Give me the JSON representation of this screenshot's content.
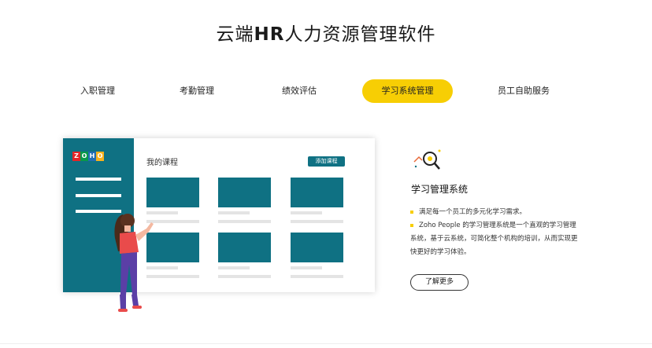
{
  "header": {
    "title_prefix": "云端",
    "title_bold": "HR",
    "title_suffix": "人力资源管理软件"
  },
  "tabs": [
    {
      "label": "入职管理"
    },
    {
      "label": "考勤管理"
    },
    {
      "label": "绩效评估"
    },
    {
      "label": "学习系统管理",
      "active": true
    },
    {
      "label": "员工自助服务"
    }
  ],
  "mockup": {
    "logo_letters": [
      "Z",
      "O",
      "H",
      "O"
    ],
    "logo_colors": [
      "#e42527",
      "#089949",
      "#226db4",
      "#f9b21d"
    ],
    "course_title": "我的课程",
    "add_button": "添加课程"
  },
  "feature": {
    "icon": "magnifier-icon",
    "title": "学习管理系统",
    "bullets": [
      "满足每一个员工的多元化学习需求。",
      "Zoho People 的学习管理系统是一个直观的学习管理"
    ],
    "continuation": [
      "系统，基于云系统，可简化整个机构的培训，从而实现更",
      "快更好的学习体验。"
    ],
    "more_button": "了解更多"
  },
  "colors": {
    "accent": "#f7ce04",
    "teal": "#0f7183"
  }
}
